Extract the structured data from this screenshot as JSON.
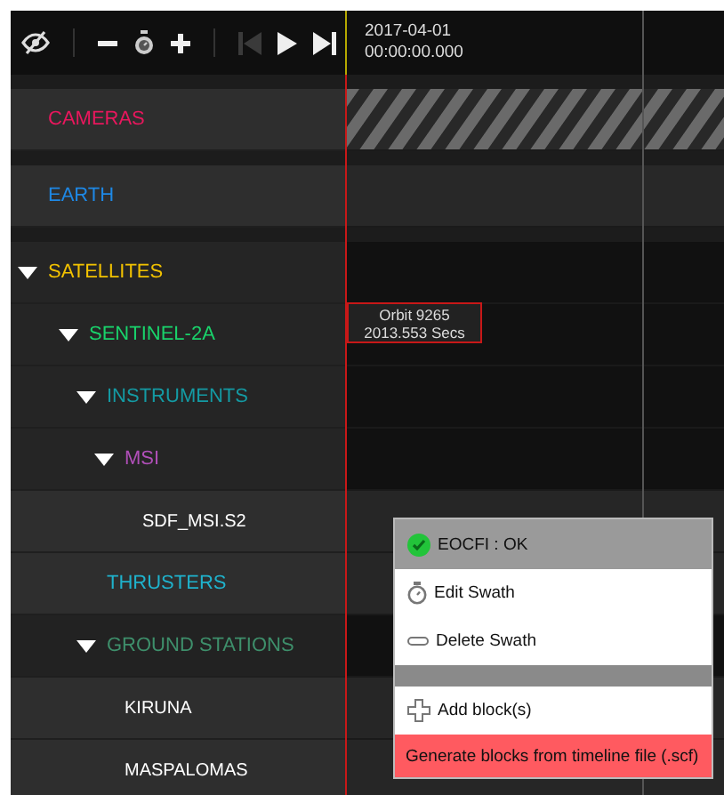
{
  "toolbar": {
    "previous_disabled": true,
    "date": "2017-04-01",
    "time": "00:00:00.000"
  },
  "tree": [
    {
      "label": "CAMERAS",
      "color": "#e8175d",
      "hatched": true
    },
    {
      "label": "EARTH",
      "color": "#1e88e5"
    },
    {
      "label": "SATELLITES",
      "color": "#f2c200",
      "expanded": true,
      "children": [
        {
          "label": "SENTINEL-2A",
          "color": "#19d36b",
          "expanded": true,
          "children": [
            {
              "label": "INSTRUMENTS",
              "color": "#149aa3",
              "expanded": true,
              "children": [
                {
                  "label": "MSI",
                  "color": "#b04fb8",
                  "expanded": true,
                  "children": [
                    {
                      "label": "SDF_MSI.S2",
                      "color": "#ffffff"
                    }
                  ]
                }
              ]
            },
            {
              "label": "THRUSTERS",
              "color": "#1fb2cc"
            },
            {
              "label": "GROUND STATIONS",
              "color": "#3e8f6b",
              "expanded": true,
              "children": [
                {
                  "label": "KIRUNA",
                  "color": "#ffffff"
                },
                {
                  "label": "MASPALOMAS",
                  "color": "#ffffff"
                }
              ]
            }
          ]
        }
      ]
    }
  ],
  "orbit_label": {
    "orbit": "Orbit 9265",
    "duration": "2013.553 Secs"
  },
  "context_menu": [
    {
      "kind": "status",
      "label": "EOCFI : OK"
    },
    {
      "kind": "edit",
      "label": "Edit Swath"
    },
    {
      "kind": "delete",
      "label": "Delete Swath"
    },
    {
      "kind": "separator"
    },
    {
      "kind": "add",
      "label": "Add block(s)"
    },
    {
      "kind": "generate",
      "label": "Generate blocks from timeline file (.scf)"
    }
  ]
}
